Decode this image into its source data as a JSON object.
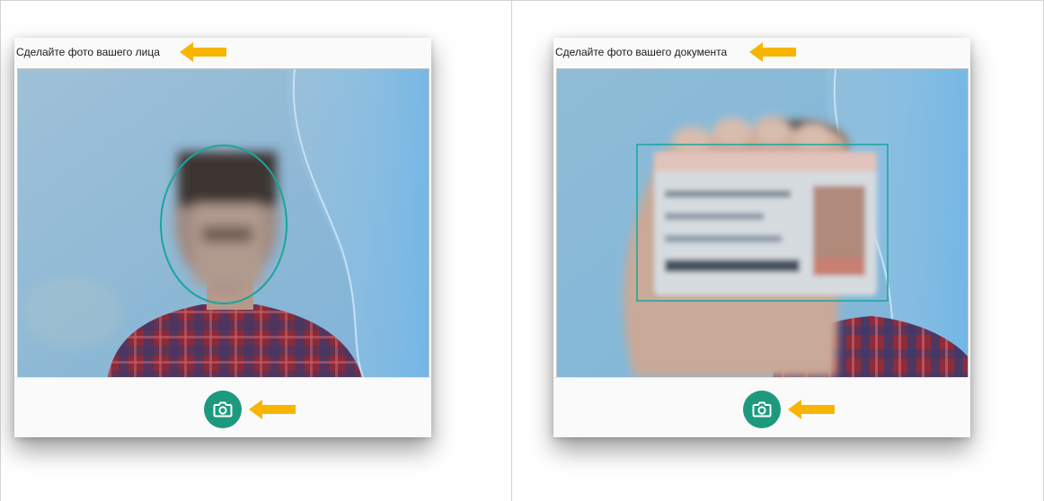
{
  "panels": [
    {
      "id": "face",
      "title": "Сделайте фото вашего лица",
      "capture_icon": "camera-icon",
      "hint_icon": "arrow-left-icon"
    },
    {
      "id": "document",
      "title": "Сделайте фото вашего документа",
      "capture_icon": "camera-icon",
      "hint_icon": "arrow-left-icon"
    }
  ],
  "colors": {
    "accent": "#1d9a7e",
    "arrow": "#f7b500",
    "guide": "#1aa59a",
    "background_blue": "#8ab7d4"
  }
}
